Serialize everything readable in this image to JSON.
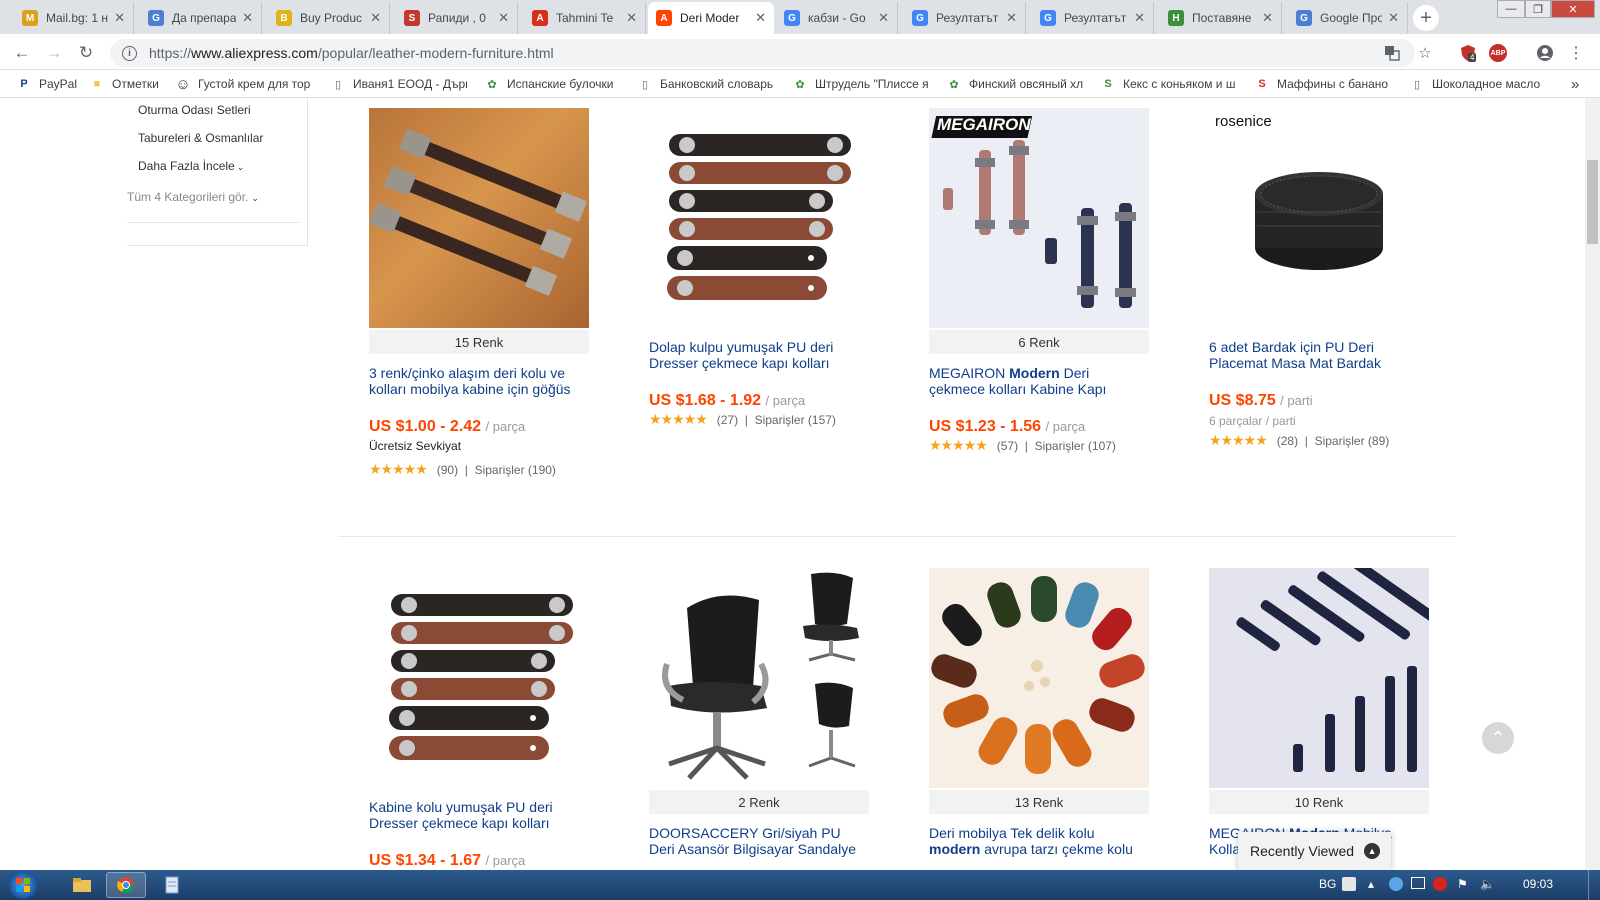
{
  "tabs": [
    {
      "title": "Mail.bg: 1 н",
      "color": "#d9a21b",
      "glyph": "M"
    },
    {
      "title": "Да препара",
      "color": "#4a7fd1",
      "glyph": "G"
    },
    {
      "title": "Buy Produc",
      "color": "#e0b21b",
      "glyph": "B"
    },
    {
      "title": "Рапиди , 0",
      "color": "#c0392b",
      "glyph": "S"
    },
    {
      "title": "Tahmini Te",
      "color": "#d5301c",
      "glyph": "A"
    },
    {
      "title": "Deri Moder",
      "color": "#ff4400",
      "glyph": "A"
    },
    {
      "title": "кабзи - Go",
      "color": "#4285f4",
      "glyph": "G"
    },
    {
      "title": "Резултатът",
      "color": "#4285f4",
      "glyph": "G"
    },
    {
      "title": "Резултатът",
      "color": "#4285f4",
      "glyph": "G"
    },
    {
      "title": "Поставяне",
      "color": "#3a8f3a",
      "glyph": "H"
    },
    {
      "title": "Google Про",
      "color": "#4a7fd1",
      "glyph": "G"
    }
  ],
  "window": {
    "minimize": "—",
    "maximize": "❐",
    "close": "✕"
  },
  "address_bar": {
    "url_prefix": "https://",
    "url_host": "www.aliexpress.com",
    "url_path": "/popular/leather-modern-furniture.html"
  },
  "toolbar_badges": {
    "extension_count": "4",
    "abp_label": "ABP"
  },
  "bookmarks": [
    {
      "label": "PayPal",
      "glyph": "P",
      "color": "#1a3f8a"
    },
    {
      "label": "Отметки",
      "glyph": "■",
      "color": "#f2c744"
    },
    {
      "label": "Густой крем для тор",
      "glyph": "☺",
      "color": "#333"
    },
    {
      "label": "Иваня1 ЕООД - Дърв",
      "glyph": "▯",
      "color": "#666"
    },
    {
      "label": "Испанские булочки",
      "glyph": "✿",
      "color": "#3a8f3a"
    },
    {
      "label": "Банковский словарь",
      "glyph": "▯",
      "color": "#666"
    },
    {
      "label": "Штрудель \"Плиссе я",
      "glyph": "✿",
      "color": "#3a8f3a"
    },
    {
      "label": "Финский овсяный хл",
      "glyph": "✿",
      "color": "#3a8f3a"
    },
    {
      "label": "Кекс с коньяком и ш",
      "glyph": "S",
      "color": "#3a8f3a"
    },
    {
      "label": "Маффины с банано",
      "glyph": "S",
      "color": "#d5301c"
    },
    {
      "label": "Шоколадное масло",
      "glyph": "▯",
      "color": "#666"
    }
  ],
  "bookmarks_overflow": "»",
  "sidebar": {
    "links": [
      "Oturma Odası Setleri",
      "Tabureleri & Osmanlılar",
      "Daha Fazla İncele"
    ],
    "more_categories": "Tüm 4 Kategorileri gör."
  },
  "products": [
    {
      "colors": "15 Renk",
      "title": "3 renk/çinko alaşım deri kolu ve kolları mobilya kabine için göğüs",
      "price": "US $1.00 - 2.42",
      "unit": "/ parça",
      "shipping": "Ücretsiz Sevkiyat",
      "stars": "★★★★★",
      "reviews": "(90)",
      "orders": "Siparişler (190)"
    },
    {
      "colors": "",
      "title": "Dolap kulpu yumuşak PU deri Dresser çekmece kapı kolları",
      "price": "US $1.68 - 1.92",
      "unit": "/ parça",
      "stars": "★★★★★",
      "reviews": "(27)",
      "orders": "Siparişler (157)"
    },
    {
      "colors": "6 Renk",
      "title_pre": "MEGAIRON ",
      "title_bold": "Modern",
      "title_post": " Deri çekmece kolları Kabine Kapı",
      "price": "US $1.23 - 1.56",
      "unit": "/ parça",
      "stars": "★★★★★",
      "reviews": "(57)",
      "orders": "Siparişler (107)",
      "brand": "MEGAIRON"
    },
    {
      "colors": "",
      "title": "6 adet Bardak için PU Deri Placemat Masa Mat Bardak",
      "price": "US $8.75",
      "unit": "/ parti",
      "lot": "6 parçalar / parti",
      "stars": "★★★★★",
      "reviews": "(28)",
      "orders": "Siparişler (89)",
      "brand": "rosenice"
    },
    {
      "colors": "",
      "title": "Kabine kolu yumuşak PU deri Dresser çekmece kapı kolları",
      "price": "US $1.34 - 1.67",
      "unit": "/ parça"
    },
    {
      "colors": "2 Renk",
      "title": "DOORSACCERY Gri/siyah PU Deri Asansör Bilgisayar Sandalye"
    },
    {
      "colors": "13 Renk",
      "title_pre": "Deri mobilya Tek delik kolu ",
      "title_bold": "modern",
      "title_post": " avrupa tarzı çekme kolu"
    },
    {
      "colors": "10 Renk",
      "title_pre": "MEGAIRON ",
      "title_bold": "Modern",
      "title_post": " Mobilya Kolları"
    }
  ],
  "recently_viewed": "Recently Viewed",
  "taskbar": {
    "lang": "BG",
    "clock": "09:03"
  }
}
